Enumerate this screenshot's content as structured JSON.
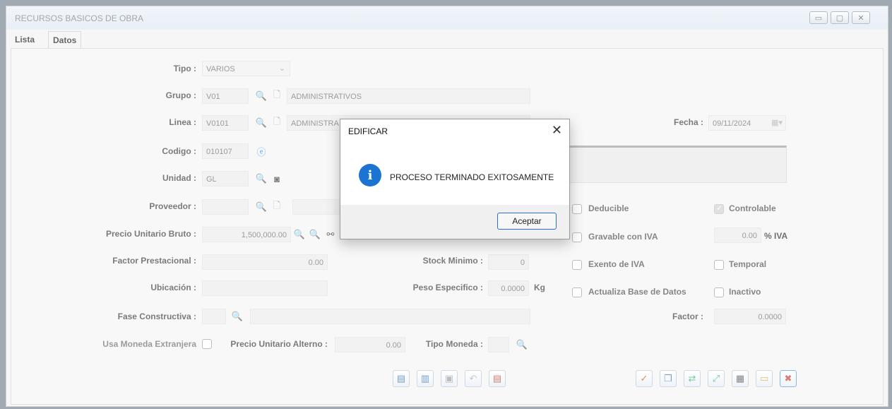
{
  "window": {
    "title": "RECURSOS BASICOS DE OBRA",
    "controls": [
      "minimize-icon",
      "maximize-icon",
      "close-icon"
    ]
  },
  "tabs": [
    {
      "label": "Lista"
    },
    {
      "label": "Datos"
    }
  ],
  "form": {
    "tipo": {
      "label": "Tipo :",
      "value": "VARIOS"
    },
    "grupo": {
      "label": "Grupo :",
      "code": "V01",
      "desc": "ADMINISTRATIVOS"
    },
    "linea": {
      "label": "Linea :",
      "code": "V0101",
      "desc": "ADMINISTRA"
    },
    "codigo": {
      "label": "Codigo :",
      "value": "010107"
    },
    "unidad": {
      "label": "Unidad :",
      "value": "GL"
    },
    "proveedor": {
      "label": "Proveedor :"
    },
    "precio_bruto": {
      "label": "Precio Unitario Bruto :",
      "value": "1,500,000.00"
    },
    "factor_prestacional": {
      "label": "Factor Prestacional :",
      "value": "0.00"
    },
    "stock_minimo": {
      "label": "Stock Minimo :",
      "value": "0"
    },
    "ubicacion": {
      "label": "Ubicación :"
    },
    "peso_especifico": {
      "label": "Peso Especifico :",
      "value": "0.0000",
      "unit": "Kg"
    },
    "fase_constructiva": {
      "label": "Fase Constructiva :"
    },
    "factor": {
      "label": "Factor :",
      "value": "0.0000"
    },
    "usa_moneda": {
      "label": "Usa Moneda Extranjera"
    },
    "precio_alterno": {
      "label": "Precio Unitario Alterno :",
      "value": "0.00"
    },
    "tipo_moneda": {
      "label": "Tipo Moneda :"
    },
    "fecha": {
      "label": "Fecha :",
      "value": "09/11/2024"
    },
    "iva": {
      "value": "0.00",
      "label": "% IVA"
    },
    "checks": {
      "deducible": "Deducible",
      "controlable": "Controlable",
      "gravable": "Gravable con IVA",
      "exento": "Exento de IVA",
      "temporal": "Temporal",
      "actualiza": "Actualiza Base de Datos",
      "inactivo": "Inactivo"
    }
  },
  "dialog": {
    "title": "EDIFICAR",
    "message": "PROCESO TERMINADO EXITOSAMENTE",
    "ok_label": "Aceptar",
    "icon": "info-icon"
  }
}
